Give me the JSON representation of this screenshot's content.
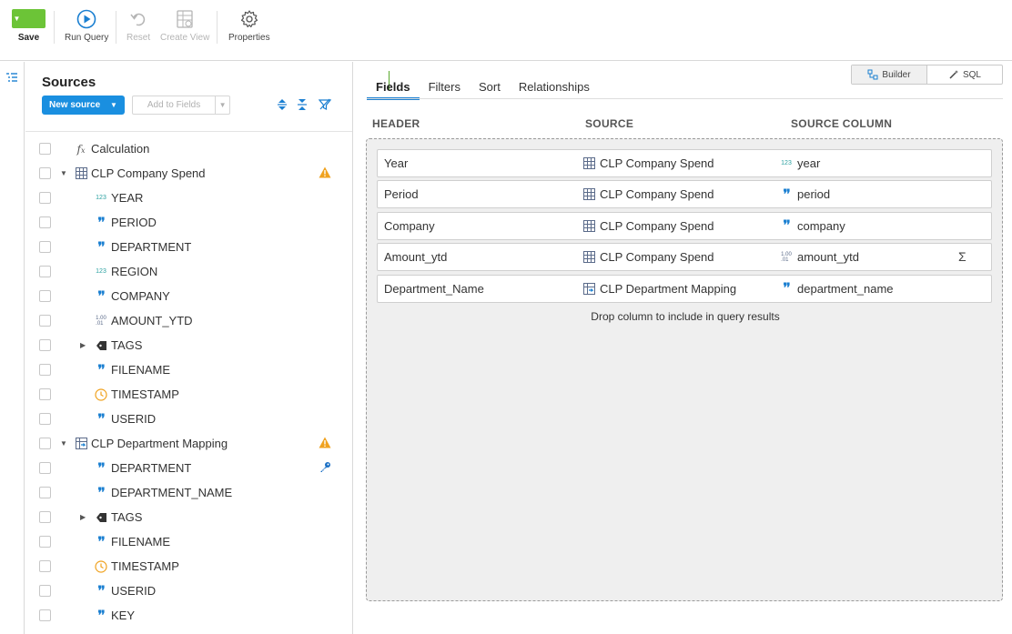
{
  "toolbar": {
    "save": "Save",
    "run_query": "Run Query",
    "reset": "Reset",
    "create_view": "Create View",
    "properties": "Properties"
  },
  "sources": {
    "title": "Sources",
    "new_source": "New source",
    "add_to_fields": "Add to Fields",
    "items": [
      {
        "label": "Calculation",
        "icon": "fx-icon",
        "level": 0
      },
      {
        "label": "CLP Company Spend",
        "icon": "table-icon",
        "level": 0,
        "expandable": true,
        "expanded": true,
        "warning": true
      },
      {
        "label": "YEAR",
        "icon": "integer-icon",
        "level": 1
      },
      {
        "label": "PERIOD",
        "icon": "text-quote-icon",
        "level": 1
      },
      {
        "label": "DEPARTMENT",
        "icon": "text-quote-icon",
        "level": 1
      },
      {
        "label": "REGION",
        "icon": "integer-icon",
        "level": 1
      },
      {
        "label": "COMPANY",
        "icon": "text-quote-icon",
        "level": 1
      },
      {
        "label": "AMOUNT_YTD",
        "icon": "decimal-icon",
        "level": 1
      },
      {
        "label": "TAGS",
        "icon": "tag-icon",
        "level": 1,
        "expandable": true
      },
      {
        "label": "FILENAME",
        "icon": "text-quote-icon",
        "level": 1
      },
      {
        "label": "TIMESTAMP",
        "icon": "clock-icon",
        "level": 1
      },
      {
        "label": "USERID",
        "icon": "text-quote-icon",
        "level": 1
      },
      {
        "label": "CLP Department Mapping",
        "icon": "mapping-table-icon",
        "level": 0,
        "expandable": true,
        "expanded": true,
        "warning": true
      },
      {
        "label": "DEPARTMENT",
        "icon": "text-quote-icon",
        "level": 1,
        "key": true
      },
      {
        "label": "DEPARTMENT_NAME",
        "icon": "text-quote-icon",
        "level": 1
      },
      {
        "label": "TAGS",
        "icon": "tag-icon",
        "level": 1,
        "expandable": true
      },
      {
        "label": "FILENAME",
        "icon": "text-quote-icon",
        "level": 1
      },
      {
        "label": "TIMESTAMP",
        "icon": "clock-icon",
        "level": 1
      },
      {
        "label": "USERID",
        "icon": "text-quote-icon",
        "level": 1
      },
      {
        "label": "KEY",
        "icon": "text-quote-icon",
        "level": 1
      }
    ]
  },
  "main": {
    "mode_toggle": {
      "builder": "Builder",
      "sql": "SQL",
      "active": "builder"
    },
    "tabs": [
      "Fields",
      "Filters",
      "Sort",
      "Relationships"
    ],
    "active_tab": "Fields",
    "columns": {
      "header": "HEADER",
      "source": "SOURCE",
      "source_column": "SOURCE COLUMN"
    },
    "fields": [
      {
        "header": "Year",
        "source": "CLP Company Spend",
        "source_icon": "table-icon",
        "column": "year",
        "column_icon": "integer-icon"
      },
      {
        "header": "Period",
        "source": "CLP Company Spend",
        "source_icon": "table-icon",
        "column": "period",
        "column_icon": "text-quote-icon"
      },
      {
        "header": "Company",
        "source": "CLP Company Spend",
        "source_icon": "table-icon",
        "column": "company",
        "column_icon": "text-quote-icon"
      },
      {
        "header": "Amount_ytd",
        "source": "CLP Company Spend",
        "source_icon": "table-icon",
        "column": "amount_ytd",
        "column_icon": "decimal-icon",
        "aggregate": true
      },
      {
        "header": "Department_Name",
        "source": "CLP Department Mapping",
        "source_icon": "mapping-table-icon",
        "column": "department_name",
        "column_icon": "text-quote-icon"
      }
    ],
    "drop_hint": "Drop column to include in query results"
  },
  "colors": {
    "accent": "#1a8fe0",
    "save_green": "#6cc437",
    "warning": "#f0a21f"
  }
}
